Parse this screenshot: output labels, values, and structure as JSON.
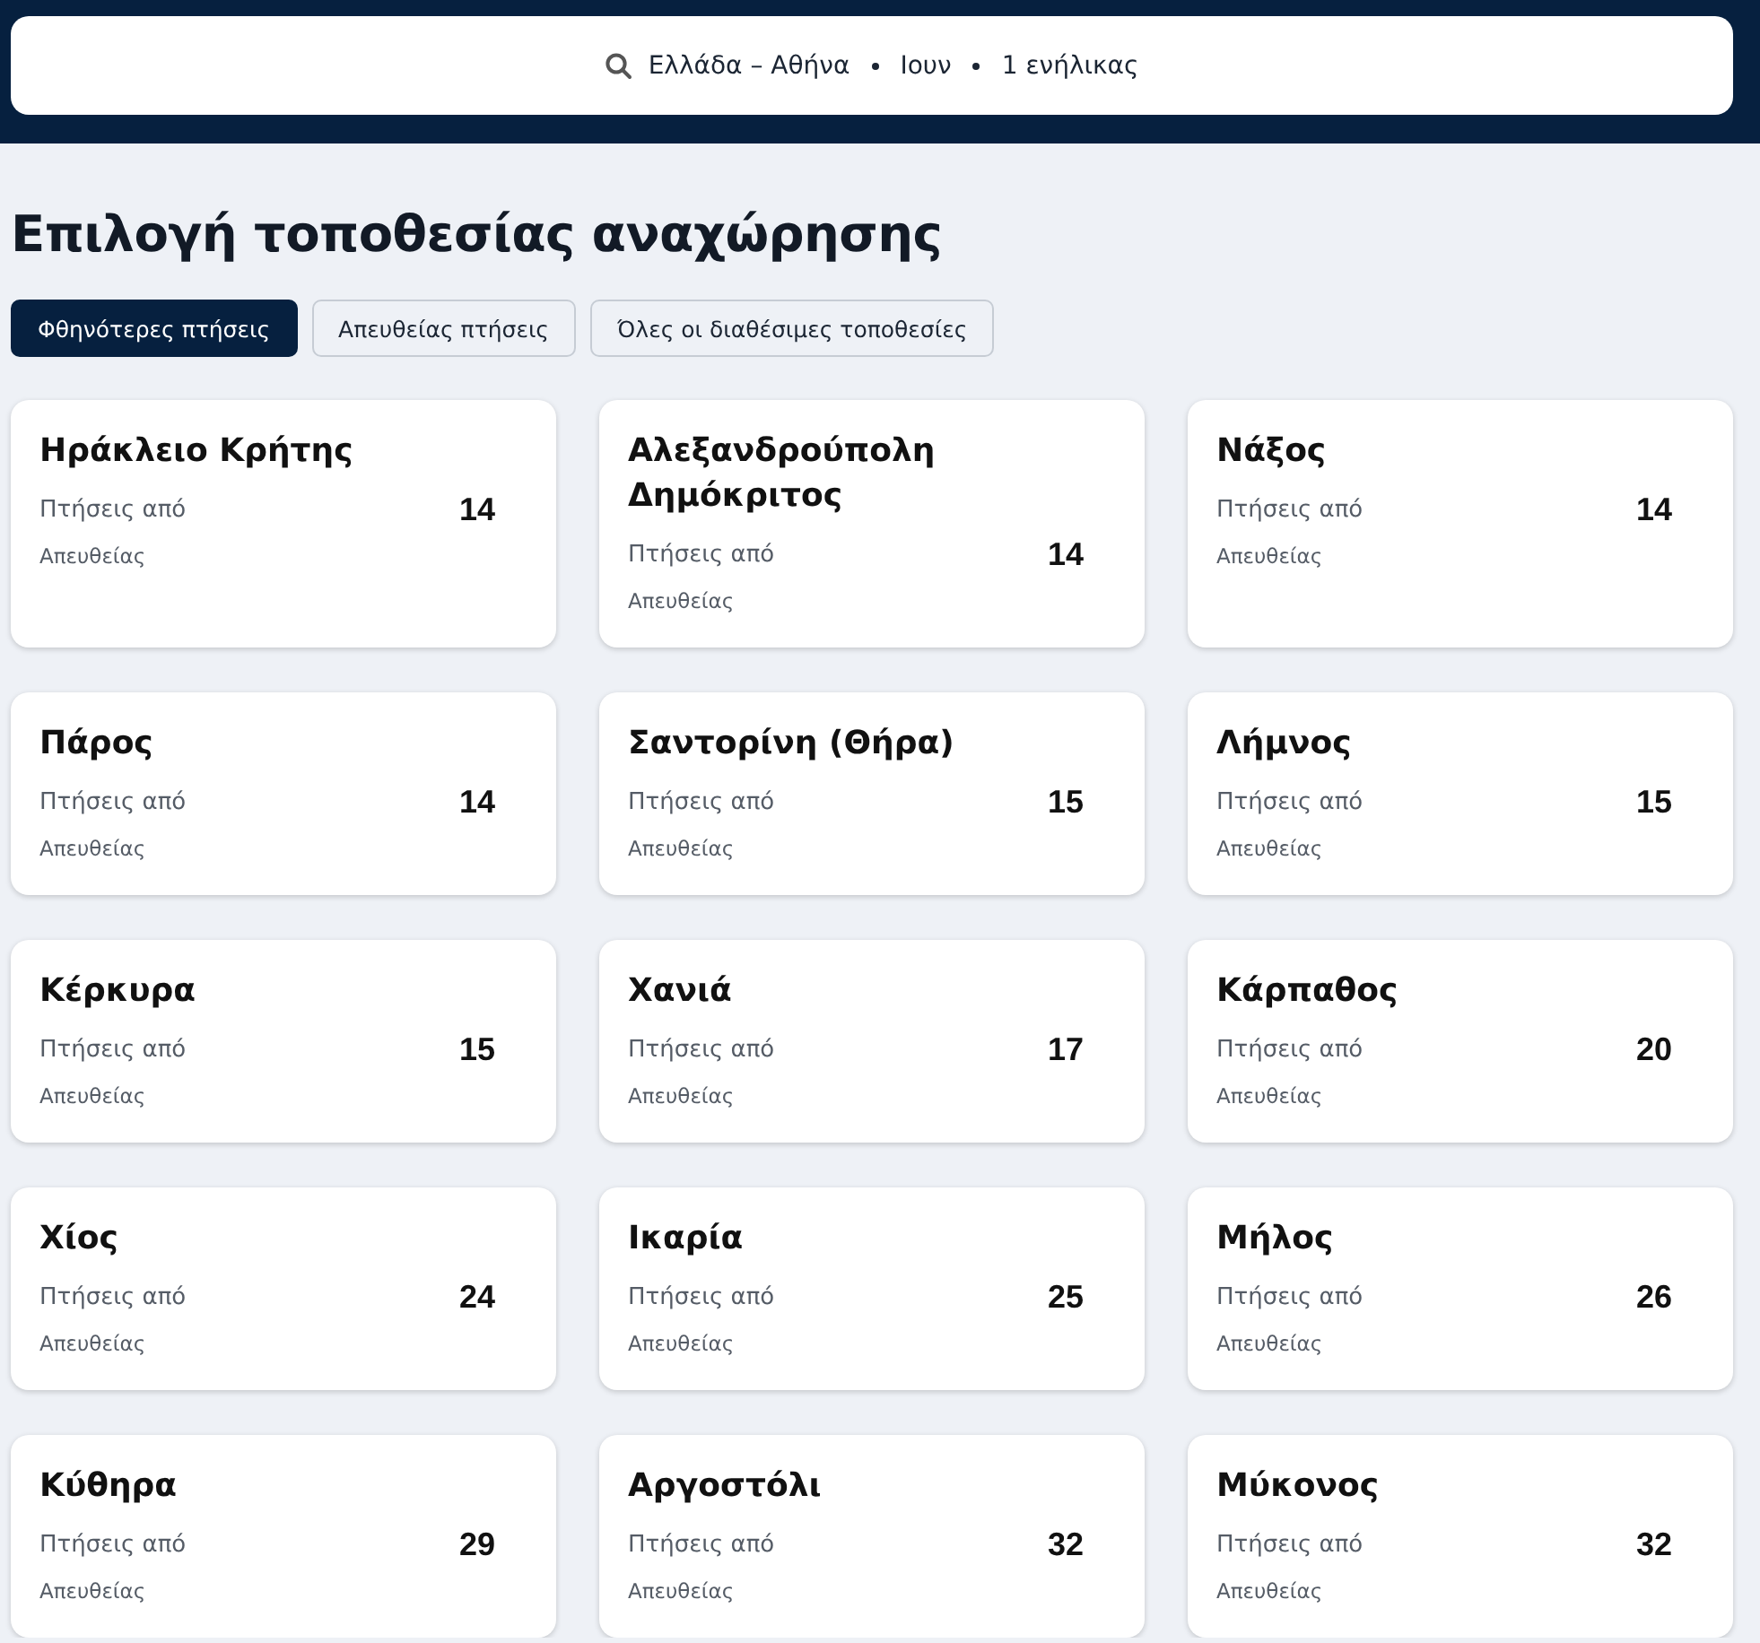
{
  "search": {
    "parts": [
      "Ελλάδα – Αθήνα",
      "Ιουν",
      "1 ενήλικας"
    ]
  },
  "title": "Επιλογή τοποθεσίας αναχώρησης",
  "tabs": [
    {
      "label": "Φθηνότερες πτήσεις",
      "selected": true
    },
    {
      "label": "Απευθείας πτήσεις",
      "selected": false
    },
    {
      "label": "Όλες οι διαθέσιμες τοποθεσίες",
      "selected": false
    }
  ],
  "destinations": [
    {
      "name": "Ηράκλειο Κρήτης",
      "label": "Πτήσεις από",
      "price": "14",
      "note": "Απευθείας"
    },
    {
      "name": "Αλεξανδρούπολη Δημόκριτος",
      "label": "Πτήσεις από",
      "price": "14",
      "note": "Απευθείας"
    },
    {
      "name": "Νάξος",
      "label": "Πτήσεις από",
      "price": "14",
      "note": "Απευθείας"
    },
    {
      "name": "Πάρος",
      "label": "Πτήσεις από",
      "price": "14",
      "note": "Απευθείας"
    },
    {
      "name": "Σαντορίνη (Θήρα)",
      "label": "Πτήσεις από",
      "price": "15",
      "note": "Απευθείας"
    },
    {
      "name": "Λήμνος",
      "label": "Πτήσεις από",
      "price": "15",
      "note": "Απευθείας"
    },
    {
      "name": "Κέρκυρα",
      "label": "Πτήσεις από",
      "price": "15",
      "note": "Απευθείας"
    },
    {
      "name": "Χανιά",
      "label": "Πτήσεις από",
      "price": "17",
      "note": "Απευθείας"
    },
    {
      "name": "Κάρπαθος",
      "label": "Πτήσεις από",
      "price": "20",
      "note": "Απευθείας"
    },
    {
      "name": "Χίος",
      "label": "Πτήσεις από",
      "price": "24",
      "note": "Απευθείας"
    },
    {
      "name": "Ικαρία",
      "label": "Πτήσεις από",
      "price": "25",
      "note": "Απευθείας"
    },
    {
      "name": "Μήλος",
      "label": "Πτήσεις από",
      "price": "26",
      "note": "Απευθείας"
    },
    {
      "name": "Κύθηρα",
      "label": "Πτήσεις από",
      "price": "29",
      "note": "Απευθείας"
    },
    {
      "name": "Αργοστόλι",
      "label": "Πτήσεις από",
      "price": "32",
      "note": "Απευθείας"
    },
    {
      "name": "Μύκονος",
      "label": "Πτήσεις από",
      "price": "32",
      "note": "Απευθείας"
    }
  ]
}
